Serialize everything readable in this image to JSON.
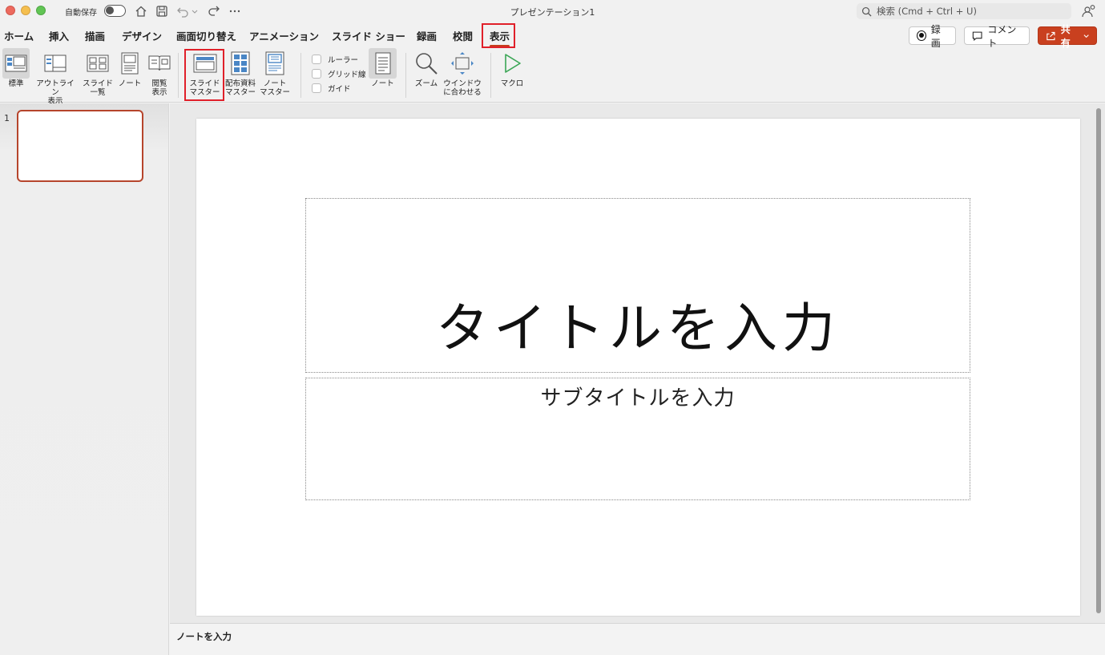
{
  "titlebar": {
    "autosave_label": "自動保存",
    "doc_title": "プレゼンテーション1",
    "search_placeholder": "検索 (Cmd + Ctrl + U)"
  },
  "tabs": [
    {
      "label": "ホーム"
    },
    {
      "label": "挿入"
    },
    {
      "label": "描画"
    },
    {
      "label": "デザイン"
    },
    {
      "label": "画面切り替え"
    },
    {
      "label": "アニメーション"
    },
    {
      "label": "スライド ショー"
    },
    {
      "label": "録画"
    },
    {
      "label": "校閲"
    },
    {
      "label": "表示"
    }
  ],
  "header_buttons": {
    "record": "録画",
    "comment": "コメント",
    "share": "共有"
  },
  "ribbon": {
    "normal": "標準",
    "outline": "アウトライン\n表示",
    "sorter": "スライド\n一覧",
    "notes_page": "ノート",
    "reading": "閲覧\n表示",
    "slide_master": "スライド\nマスター",
    "handout_master": "配布資料\nマスター",
    "notes_master": "ノート\nマスター",
    "ruler": "ルーラー",
    "gridlines": "グリッド線",
    "guides": "ガイド",
    "notes": "ノート",
    "zoom": "ズーム",
    "fit_window": "ウインドウ\nに合わせる",
    "macro": "マクロ"
  },
  "thumbnails": [
    {
      "number": "1"
    }
  ],
  "slide": {
    "title_placeholder": "タイトルを入力",
    "subtitle_placeholder": "サブタイトルを入力"
  },
  "notes_placeholder": "ノートを入力",
  "colors": {
    "accent": "#c43e1c",
    "share_button": "#c9401f",
    "highlight": "#e0202a"
  }
}
